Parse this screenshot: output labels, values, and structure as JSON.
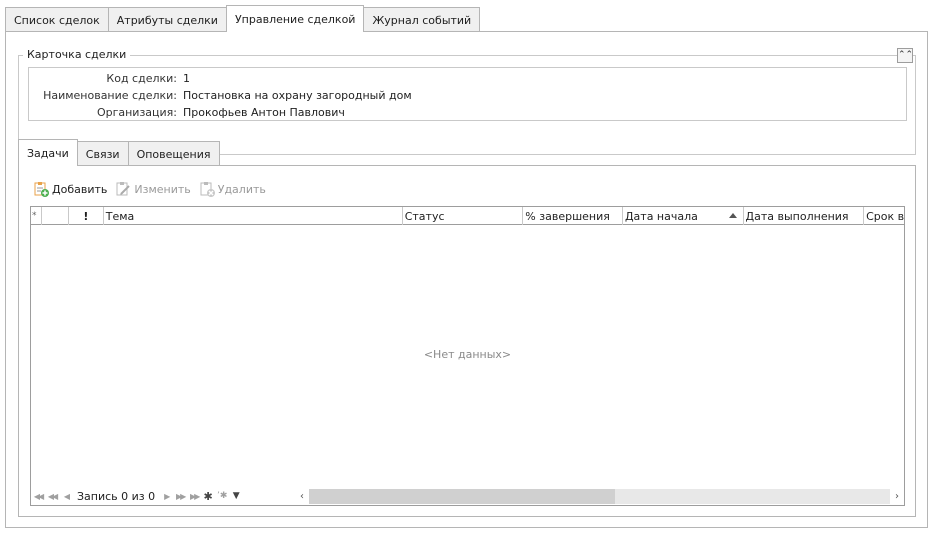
{
  "top_tabs": [
    {
      "label": "Список сделок"
    },
    {
      "label": "Атрибуты сделки"
    },
    {
      "label": "Управление сделкой",
      "active": true
    },
    {
      "label": "Журнал событий"
    }
  ],
  "deal_card": {
    "title": "Карточка сделки",
    "fields": [
      {
        "label": "Код сделки:",
        "value": "1"
      },
      {
        "label": "Наименование сделки:",
        "value": "Постановка на охрану загородный дом"
      },
      {
        "label": "Организация:",
        "value": "Прокофьев Антон Павлович"
      }
    ]
  },
  "inner_tabs": [
    {
      "label": "Задачи",
      "active": true
    },
    {
      "label": "Связи"
    },
    {
      "label": "Оповещения"
    }
  ],
  "toolbar": {
    "add_label": "Добавить",
    "edit_label": "Изменить",
    "delete_label": "Удалить"
  },
  "grid": {
    "columns": [
      {
        "label": "*"
      },
      {
        "label": ""
      },
      {
        "label": "!"
      },
      {
        "label": "Тема"
      },
      {
        "label": "Статус"
      },
      {
        "label": "% завершения"
      },
      {
        "label": "Дата начала",
        "sorted": "asc"
      },
      {
        "label": "Дата выполнения"
      },
      {
        "label": "Срок в"
      }
    ],
    "empty_text": "<Нет данных>",
    "record_text": "Запись 0 из 0"
  },
  "colors": {
    "border": "#b5b5b5",
    "icon_green": "#4caf50",
    "icon_orange": "#e8a24a",
    "disabled_text": "#9a9a9a"
  }
}
